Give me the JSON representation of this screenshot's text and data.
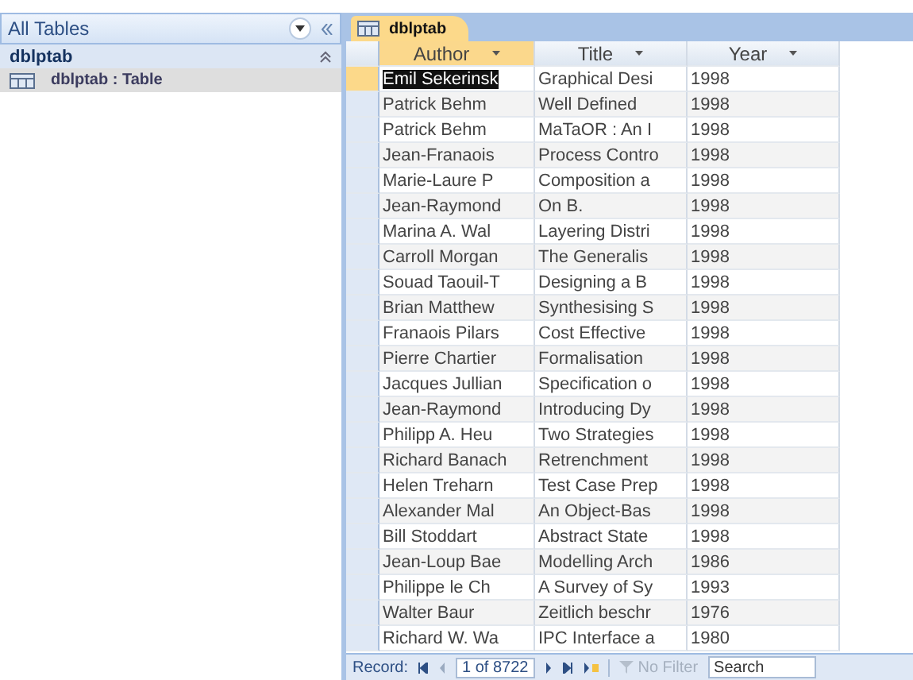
{
  "navigation_pane": {
    "title": "All Tables",
    "group": {
      "name": "dblptab",
      "expanded": true,
      "items": [
        {
          "label": "dblptab : Table",
          "selected": true
        }
      ]
    }
  },
  "document_tab": {
    "label": "dblptab",
    "selected": true
  },
  "table": {
    "columns": [
      "Author",
      "Title",
      "Year"
    ],
    "rows": [
      {
        "cells": [
          "Emil Sekerinsk",
          "Graphical Desi",
          "1998"
        ],
        "selected": true
      },
      {
        "cells": [
          "Patrick Behm",
          "Well Defined",
          "1998"
        ],
        "selected": false
      },
      {
        "cells": [
          "Patrick Behm",
          "MaTaOR : An I",
          "1998"
        ],
        "selected": false
      },
      {
        "cells": [
          "Jean-Franaois",
          "Process Contro",
          "1998"
        ],
        "selected": false
      },
      {
        "cells": [
          "Marie-Laure P",
          "Composition a",
          "1998"
        ],
        "selected": false
      },
      {
        "cells": [
          "Jean-Raymond",
          "On B.",
          "1998"
        ],
        "selected": false
      },
      {
        "cells": [
          "Marina A. Wal",
          "Layering Distri",
          "1998"
        ],
        "selected": false
      },
      {
        "cells": [
          "Carroll Morgan",
          "The Generalis",
          "1998"
        ],
        "selected": false
      },
      {
        "cells": [
          "Souad Taouil-T",
          "Designing a B",
          "1998"
        ],
        "selected": false
      },
      {
        "cells": [
          "Brian Matthew",
          "Synthesising S",
          "1998"
        ],
        "selected": false
      },
      {
        "cells": [
          "Franaois Pilars",
          "Cost Effective",
          "1998"
        ],
        "selected": false
      },
      {
        "cells": [
          "Pierre Chartier",
          "Formalisation",
          "1998"
        ],
        "selected": false
      },
      {
        "cells": [
          "Jacques Jullian",
          "Specification o",
          "1998"
        ],
        "selected": false
      },
      {
        "cells": [
          "Jean-Raymond",
          "Introducing Dy",
          "1998"
        ],
        "selected": false
      },
      {
        "cells": [
          "Philipp A. Heu",
          "Two Strategies",
          "1998"
        ],
        "selected": false
      },
      {
        "cells": [
          "Richard Banach",
          "Retrenchment",
          "1998"
        ],
        "selected": false
      },
      {
        "cells": [
          "Helen Treharn",
          "Test Case Prep",
          "1998"
        ],
        "selected": false
      },
      {
        "cells": [
          "Alexander Mal",
          "An Object-Bas",
          "1998"
        ],
        "selected": false
      },
      {
        "cells": [
          "Bill Stoddart",
          "Abstract State",
          "1998"
        ],
        "selected": false
      },
      {
        "cells": [
          "Jean-Loup Bae",
          "Modelling Arch",
          "1986"
        ],
        "selected": false
      },
      {
        "cells": [
          "Philippe le Ch",
          "A Survey of Sy",
          "1993"
        ],
        "selected": false
      },
      {
        "cells": [
          "Walter Baur",
          "Zeitlich beschr",
          "1976"
        ],
        "selected": false
      },
      {
        "cells": [
          "Richard W. Wa",
          "IPC Interface a",
          "1980"
        ],
        "selected": false
      }
    ]
  },
  "record_navigator": {
    "label": "Record:",
    "position": "1 of 8722",
    "filter": "No Filter",
    "filter_disabled": true,
    "search_placeholder": "Search"
  }
}
